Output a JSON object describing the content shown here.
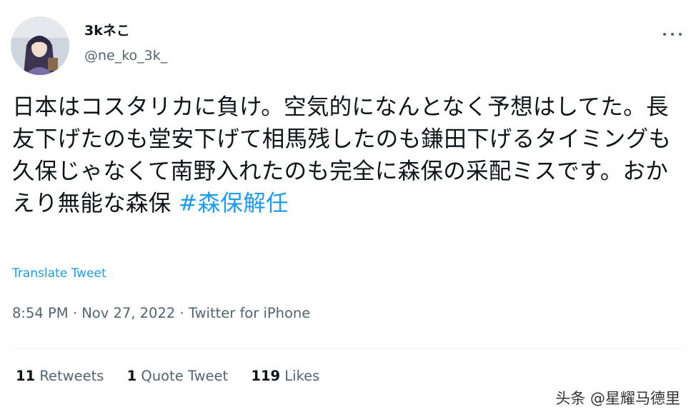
{
  "user": {
    "display_name": "3kネこ",
    "handle": "@ne_ko_3k_"
  },
  "more_icon": "more-horizontal-icon",
  "tweet": {
    "text": "日本はコスタリカに負け。空気的になんとなく予想はしてた。長友下げたのも堂安下げて相馬残したのも鎌田下げるタイミングも久保じゃなくて南野入れたのも完全に森保の采配ミスです。おかえり無能な森保 ",
    "hashtag": "#森保解任",
    "translate_label": "Translate Tweet"
  },
  "meta": {
    "time": "8:54 PM",
    "separator": " · ",
    "date": "Nov 27, 2022",
    "source": "Twitter for iPhone"
  },
  "stats": {
    "retweets_count": "11",
    "retweets_label": "Retweets",
    "quotes_count": "1",
    "quotes_label": "Quote Tweet",
    "likes_count": "119",
    "likes_label": "Likes"
  },
  "watermark": "头条 @星耀马德里",
  "colors": {
    "link": "#1d9bf0",
    "secondary_text": "#536471",
    "primary_text": "#0f1419"
  }
}
